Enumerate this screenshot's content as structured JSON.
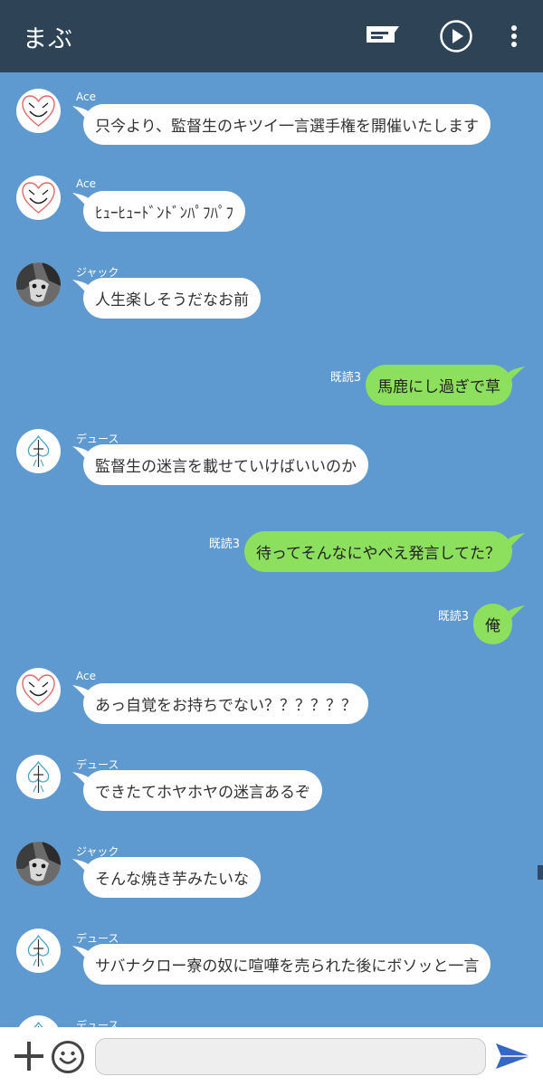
{
  "header": {
    "title": "まぶ"
  },
  "messages": [
    {
      "dir": "in",
      "sender": "Ace",
      "avatar": "heart",
      "text": "只今より、監督生のキツイ一言選手権を開催いたします"
    },
    {
      "dir": "in",
      "sender": "Ace",
      "avatar": "heart",
      "text": "ﾋｭｰﾋｭｰﾄﾞﾝﾄﾞﾝﾊﾟﾌﾊﾟﾌ"
    },
    {
      "dir": "in",
      "sender": "ジャック",
      "avatar": "wolf",
      "text": "人生楽しそうだなお前"
    },
    {
      "dir": "out",
      "read": "既読3",
      "text": "馬鹿にし過ぎで草"
    },
    {
      "dir": "in",
      "sender": "デュース",
      "avatar": "spade",
      "text": "監督生の迷言を載せていけばいいのか"
    },
    {
      "dir": "out",
      "read": "既読3",
      "text": "待ってそんなにやべえ発言してた？"
    },
    {
      "dir": "out",
      "read": "既読3",
      "text": "俺"
    },
    {
      "dir": "in",
      "sender": "Ace",
      "avatar": "heart",
      "text": "あっ自覚をお持ちでない？？？？？？"
    },
    {
      "dir": "in",
      "sender": "デュース",
      "avatar": "spade",
      "text": "できたてホヤホヤの迷言あるぞ"
    },
    {
      "dir": "in",
      "sender": "ジャック",
      "avatar": "wolf",
      "text": "そんな焼き芋みたいな"
    },
    {
      "dir": "in",
      "sender": "デュース",
      "avatar": "spade",
      "text": "サバナクロー寮の奴に喧嘩を売られた後にボソッと一言"
    },
    {
      "dir": "in",
      "sender": "デュース",
      "avatar": "spade",
      "text": ""
    }
  ],
  "input": {
    "value": "",
    "placeholder": ""
  },
  "icons": {
    "header": [
      "message-icon",
      "play-icon",
      "more-vert-icon"
    ],
    "footer": [
      "plus-icon",
      "smile-icon",
      "send-icon"
    ]
  },
  "colors": {
    "header_bg": "#2f4356",
    "chat_bg": "#5e9ad0",
    "bubble_in": "#ffffff",
    "bubble_out": "#8ddf5e",
    "send": "#3467c4"
  }
}
